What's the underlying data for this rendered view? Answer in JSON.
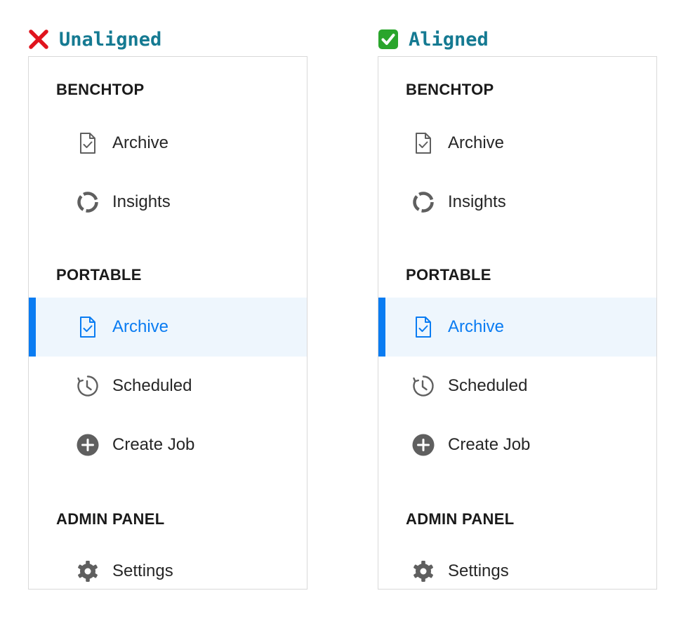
{
  "colors": {
    "title": "#157a92",
    "accent": "#0a7cf2",
    "active_bg": "#eef6fd",
    "icon": "#5f5f5f",
    "bad_mark": "#e0141e",
    "good_mark": "#2aa52c"
  },
  "panels": [
    {
      "title": "Unaligned",
      "status_icon": "cross-mark-icon",
      "sections": [
        {
          "header": "BENCHTOP",
          "items": [
            {
              "label": "Archive",
              "icon": "document-check-icon"
            },
            {
              "label": "Insights",
              "icon": "donut-chart-icon"
            }
          ]
        },
        {
          "header": "PORTABLE",
          "items": [
            {
              "label": "Archive",
              "icon": "document-check-icon",
              "active": true
            },
            {
              "label": "Scheduled",
              "icon": "clock-history-icon"
            },
            {
              "label": "Create Job",
              "icon": "plus-circle-icon"
            }
          ]
        },
        {
          "header": "ADMIN PANEL",
          "items": [
            {
              "label": "Settings",
              "icon": "gear-icon"
            }
          ]
        }
      ]
    },
    {
      "title": "Aligned",
      "status_icon": "check-mark-button-icon",
      "sections": [
        {
          "header": "BENCHTOP",
          "items": [
            {
              "label": "Archive",
              "icon": "document-check-icon"
            },
            {
              "label": "Insights",
              "icon": "donut-chart-icon"
            }
          ]
        },
        {
          "header": "PORTABLE",
          "items": [
            {
              "label": "Archive",
              "icon": "document-check-icon",
              "active": true
            },
            {
              "label": "Scheduled",
              "icon": "clock-history-icon"
            },
            {
              "label": "Create Job",
              "icon": "plus-circle-icon"
            }
          ]
        },
        {
          "header": "ADMIN PANEL",
          "items": [
            {
              "label": "Settings",
              "icon": "gear-icon"
            }
          ]
        }
      ]
    }
  ]
}
